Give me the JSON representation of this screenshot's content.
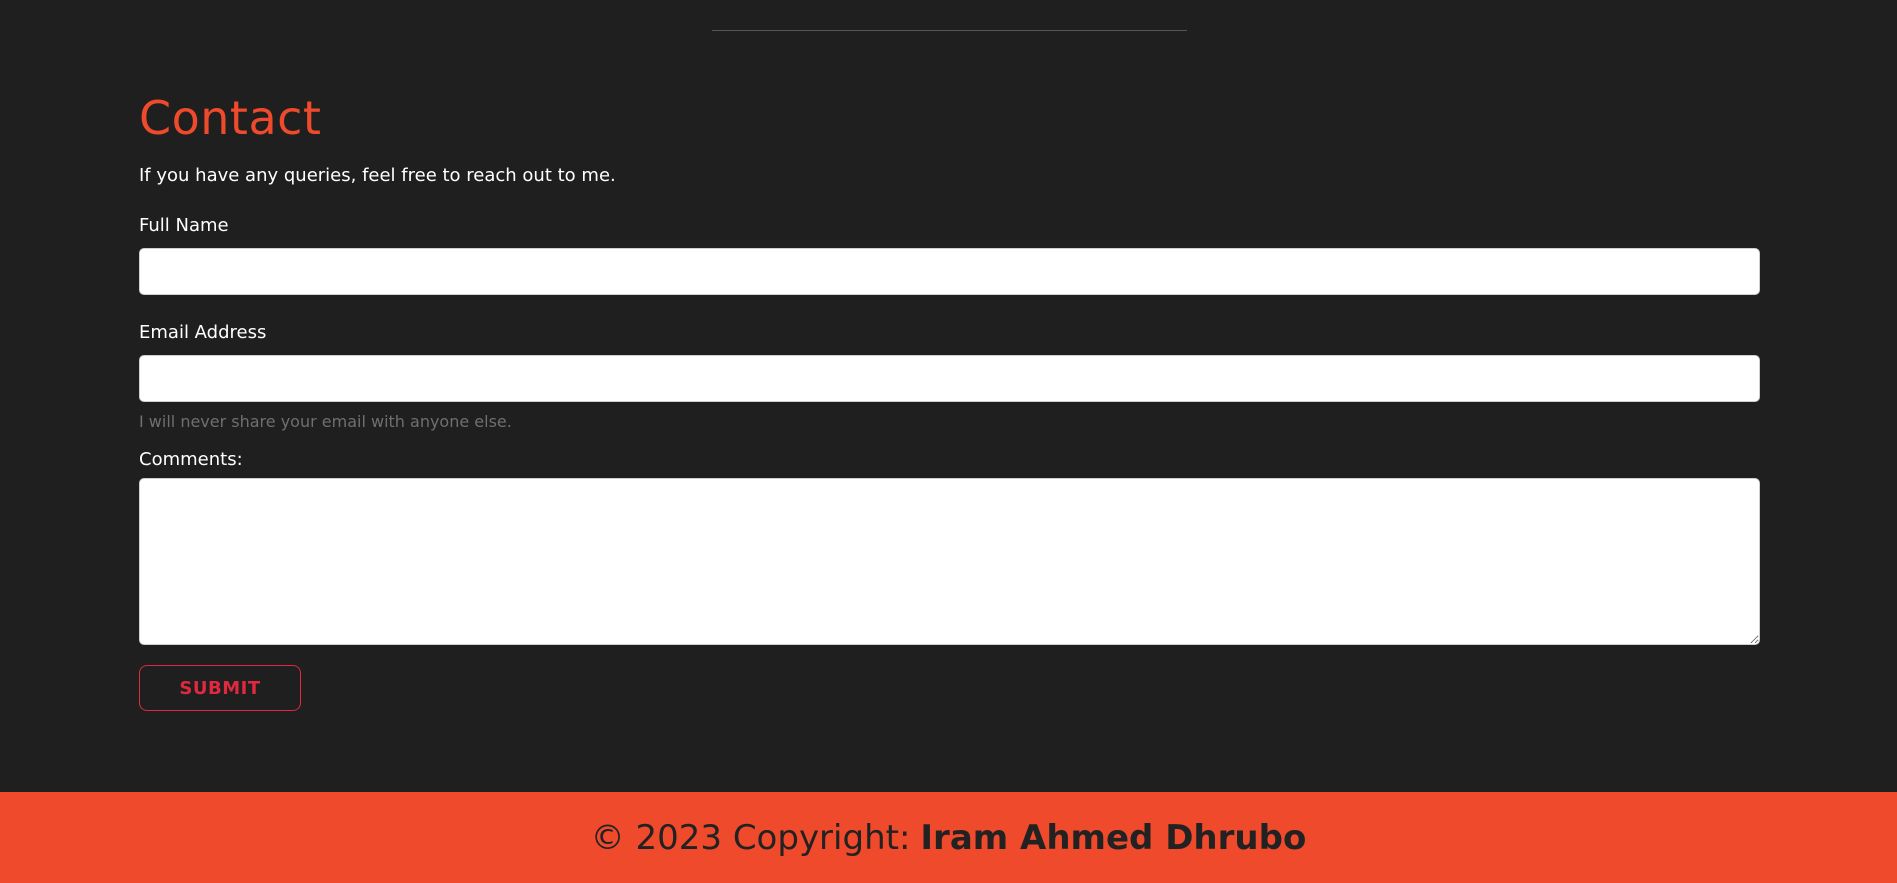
{
  "contact": {
    "title": "Contact",
    "intro": "If you have any queries, feel free to reach out to me.",
    "full_name_label": "Full Name",
    "full_name_value": "",
    "email_label": "Email Address",
    "email_value": "",
    "email_help": "I will never share your email with anyone else.",
    "comments_label": "Comments:",
    "comments_value": "",
    "submit_label": "SUBMIT"
  },
  "footer": {
    "copyright": "© 2023 Copyright:",
    "author": "Iram Ahmed Dhrubo"
  },
  "colors": {
    "background": "#1f1f1f",
    "accent": "#ef4a2b",
    "submit": "#e0283f",
    "help_text": "#6f6f6f"
  }
}
